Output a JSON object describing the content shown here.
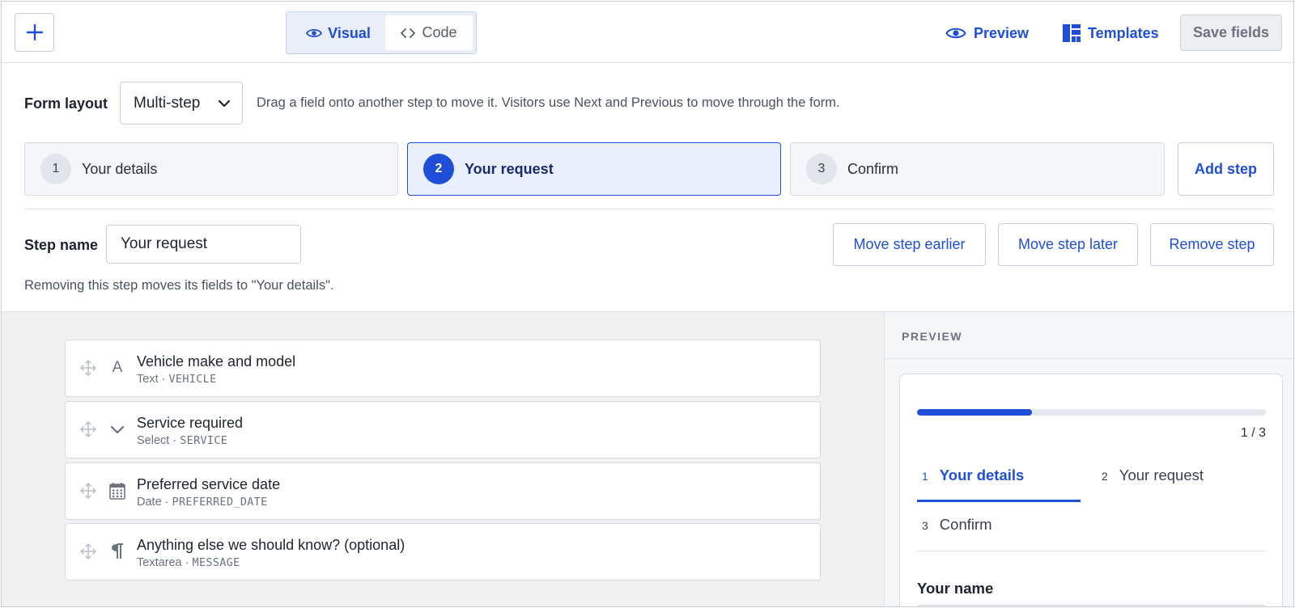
{
  "toolbar": {
    "views": {
      "visual_label": "Visual",
      "code_label": "Code",
      "active": "Visual"
    },
    "preview_label": "Preview",
    "templates_label": "Templates",
    "save_label": "Save fields"
  },
  "form_layout": {
    "label": "Form layout",
    "selected": "Multi-step",
    "hint": "Drag a field onto another step to move it. Visitors use Next and Previous to move through the form."
  },
  "steps": [
    {
      "number": "1",
      "name": "Your details",
      "active": false
    },
    {
      "number": "2",
      "name": "Your request",
      "active": true
    },
    {
      "number": "3",
      "name": "Confirm",
      "active": false
    }
  ],
  "add_step_label": "Add step",
  "step_editor": {
    "label": "Step name",
    "value": "Your request",
    "move_earlier_label": "Move step earlier",
    "move_later_label": "Move step later",
    "remove_label": "Remove step",
    "note": "Removing this step moves its fields to \"Your details\"."
  },
  "fields": [
    {
      "title": "Vehicle make and model",
      "type": "Text",
      "key": "VEHICLE",
      "icon": "text-icon"
    },
    {
      "title": "Service required",
      "type": "Select",
      "key": "SERVICE",
      "icon": "chevron-down-icon"
    },
    {
      "title": "Preferred service date",
      "type": "Date",
      "key": "PREFERRED_DATE",
      "icon": "calendar-icon"
    },
    {
      "title": "Anything else we should know? (optional)",
      "type": "Textarea",
      "key": "MESSAGE",
      "icon": "paragraph-icon"
    }
  ],
  "field_separator": "·",
  "preview": {
    "heading": "PREVIEW",
    "progress": 0.33,
    "counter": "1 / 3",
    "tabs": [
      {
        "number": "1",
        "name": "Your details",
        "active": true
      },
      {
        "number": "2",
        "name": "Your request",
        "active": false
      },
      {
        "number": "3",
        "name": "Confirm",
        "active": false
      }
    ],
    "first_field_label": "Your name"
  },
  "colors": {
    "accent": "#1f4ed8",
    "text": "#1e2330",
    "muted": "#6b7280"
  }
}
